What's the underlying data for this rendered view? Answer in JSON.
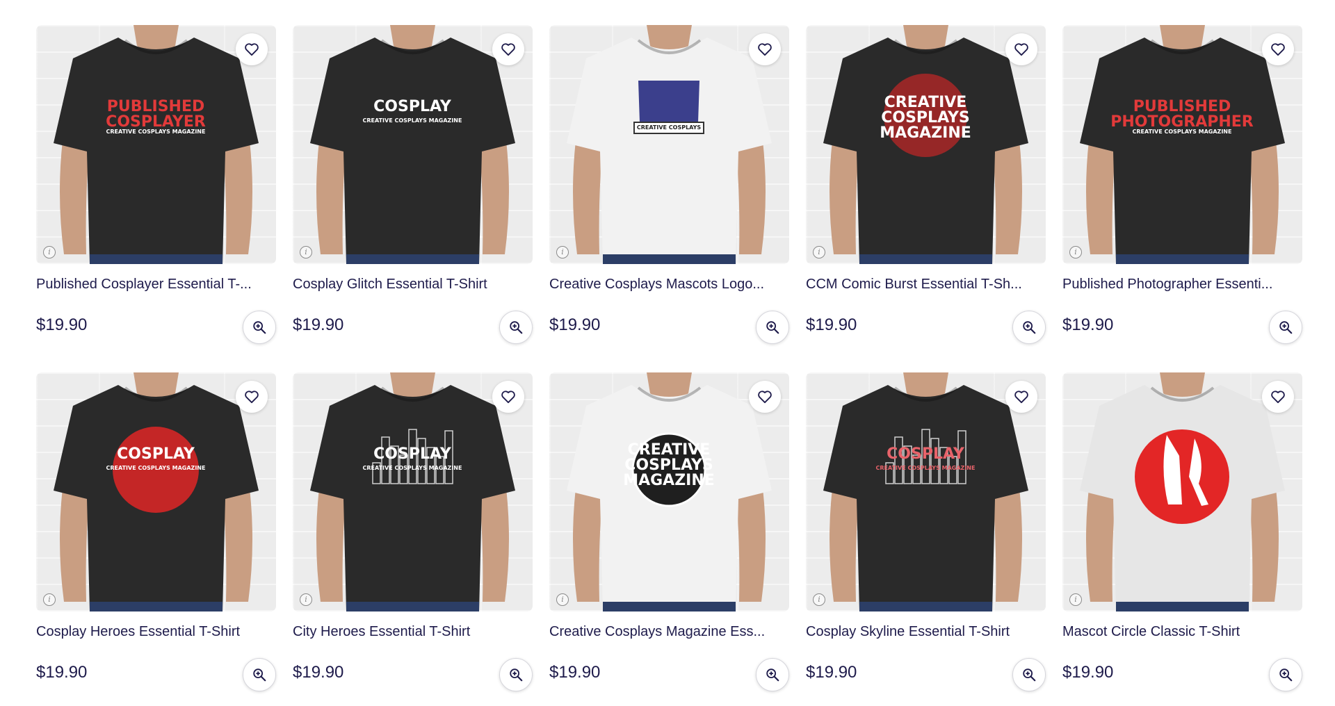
{
  "products": [
    {
      "title": "Published Cosplayer Essential T-...",
      "price": "$19.90",
      "shirt_color": "#2a2a2a",
      "print_color": "#e23a3a",
      "print_lines": [
        "PUBLISHED",
        "COSPLAYER",
        "CREATIVE COSPLAYS MAGAZINE"
      ],
      "print_shape": "text"
    },
    {
      "title": "Cosplay Glitch Essential T-Shirt",
      "price": "$19.90",
      "shirt_color": "#2a2a2a",
      "print_color": "#ffffff",
      "print_lines": [
        "COSPLAY",
        "CREATIVE COSPLAYS MAGAZINE"
      ],
      "print_shape": "text"
    },
    {
      "title": "Creative Cosplays Mascots Logo...",
      "price": "$19.90",
      "shirt_color": "#f2f2f2",
      "print_color": "#3b3f8c",
      "print_lines": [
        "CREATIVE COSPLAYS"
      ],
      "print_shape": "shield"
    },
    {
      "title": "CCM Comic Burst Essential T-Sh...",
      "price": "$19.90",
      "shirt_color": "#2a2a2a",
      "print_color": "#ffffff",
      "print_lines": [
        "CREATIVE",
        "COSPLAYS",
        "MAGAZINE"
      ],
      "print_shape": "burst"
    },
    {
      "title": "Published Photographer Essenti...",
      "price": "$19.90",
      "shirt_color": "#2a2a2a",
      "print_color": "#e23a3a",
      "print_lines": [
        "PUBLISHED",
        "PHOTOGRAPHER",
        "CREATIVE COSPLAYS MAGAZINE"
      ],
      "print_shape": "text"
    },
    {
      "title": "Cosplay Heroes Essential T-Shirt",
      "price": "$19.90",
      "shirt_color": "#2a2a2a",
      "print_color": "#ffffff",
      "print_lines": [
        "COSPLAY",
        "CREATIVE COSPLAYS MAGAZINE"
      ],
      "print_shape": "circle-red"
    },
    {
      "title": "City Heroes Essential T-Shirt",
      "price": "$19.90",
      "shirt_color": "#2a2a2a",
      "print_color": "#ffffff",
      "print_lines": [
        "COSPLAY",
        "CREATIVE COSPLAYS MAGAZINE"
      ],
      "print_shape": "city"
    },
    {
      "title": "Creative Cosplays Magazine Ess...",
      "price": "$19.90",
      "shirt_color": "#f2f2f2",
      "print_color": "#ffffff",
      "print_lines": [
        "CREATIVE",
        "COSPLAYS",
        "MAGAZINE"
      ],
      "print_shape": "circle-black"
    },
    {
      "title": "Cosplay Skyline Essential T-Shirt",
      "price": "$19.90",
      "shirt_color": "#2a2a2a",
      "print_color": "#e8636a",
      "print_lines": [
        "COSPLAY",
        "CREATIVE COSPLAYS MAGAZINE"
      ],
      "print_shape": "city"
    },
    {
      "title": "Mascot Circle Classic T-Shirt",
      "price": "$19.90",
      "shirt_color": "#e6e6e6",
      "print_color": "#e32626",
      "print_lines": [],
      "print_shape": "mascot"
    }
  ]
}
